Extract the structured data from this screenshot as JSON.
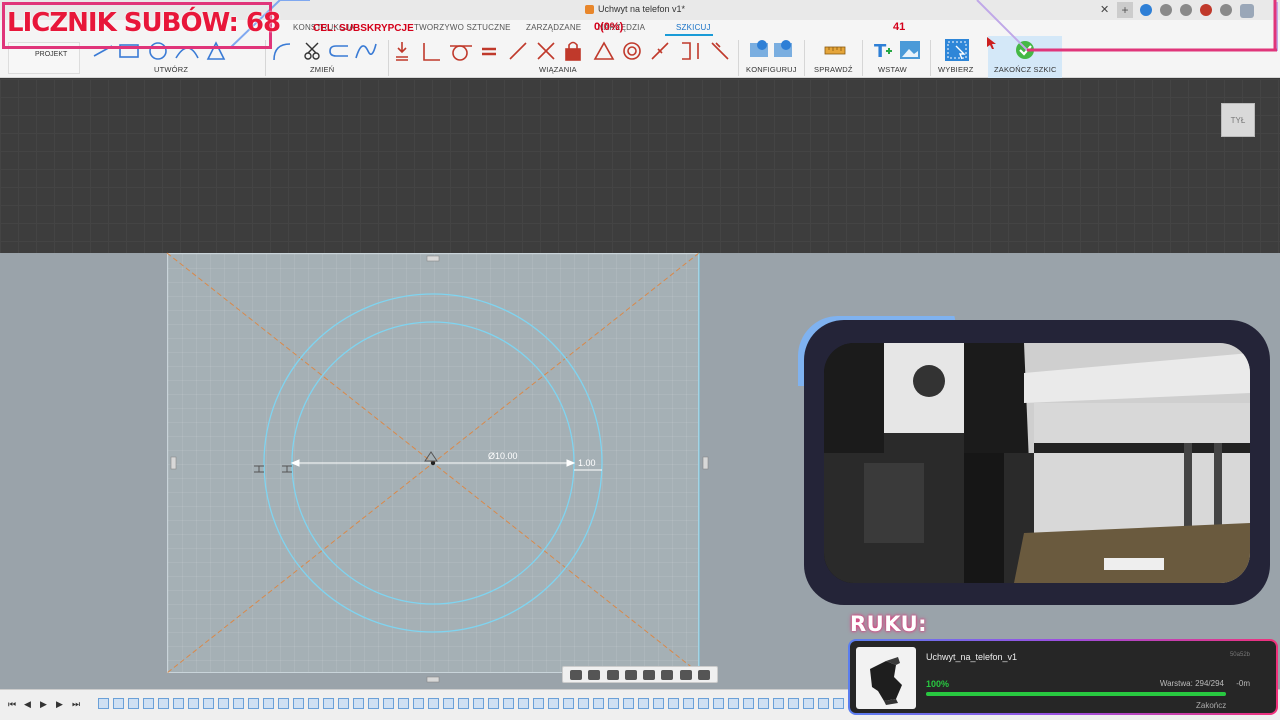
{
  "window": {
    "title": "Uchwyt na telefon v1*",
    "close_glyph": "✕",
    "plus_glyph": "+"
  },
  "tabs": [
    {
      "label": "KONSTRUKCJA"
    },
    {
      "label": "TWORZYWO SZTUCZNE"
    },
    {
      "label": "ZARZĄDZANE"
    },
    {
      "label": "NARZĘDZIA"
    },
    {
      "label": "SZKICUJ",
      "active": true
    }
  ],
  "toolbar": {
    "project_label": "PROJEKT",
    "groups": {
      "create": "UTWÓRZ",
      "modify": "ZMIEŃ",
      "constraints": "WIĄZANIA",
      "configure": "KONFIGURUJ",
      "inspect": "SPRAWDŹ",
      "insert": "WSTAW",
      "select": "WYBIERZ",
      "finish": "ZAKOŃCZ SZKIC"
    }
  },
  "sketch": {
    "diameter_label": "Ø10.00",
    "offset_label": "1.00"
  },
  "viewcube": {
    "face_label": "TYŁ"
  },
  "overlay": {
    "subs_counter": "LICZNIK SUBÓW: 68",
    "goal_label": "CEL: SUBSKRYPCJE",
    "goal_value": "0(0%)",
    "side_number": "41"
  },
  "print": {
    "heading": "RUKU:",
    "file_name": "Uchwyt_na_telefon_v1",
    "job_id": "50a52b",
    "percent_label": "100%",
    "progress": 1.0,
    "layer_label": "Warstwa: 294/294",
    "time_label": "-0m",
    "finish_label": "Zakończ"
  },
  "colors": {
    "accent_blue": "#1a9bd7",
    "sketch_line": "#7fd4f0",
    "construction_line": "#d9894a",
    "overlay_red": "#d4001a",
    "overlay_pink": "#e0357a",
    "progress_green": "#28c840"
  }
}
